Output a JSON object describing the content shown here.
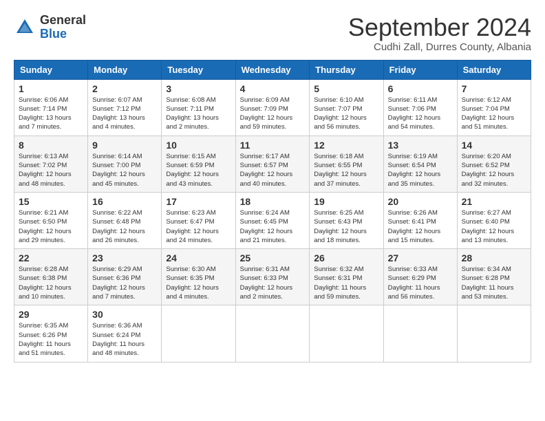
{
  "header": {
    "logo_general": "General",
    "logo_blue": "Blue",
    "month_title": "September 2024",
    "location": "Cudhi Zall, Durres County, Albania"
  },
  "days_of_week": [
    "Sunday",
    "Monday",
    "Tuesday",
    "Wednesday",
    "Thursday",
    "Friday",
    "Saturday"
  ],
  "weeks": [
    [
      {
        "day": "1",
        "info": "Sunrise: 6:06 AM\nSunset: 7:14 PM\nDaylight: 13 hours\nand 7 minutes."
      },
      {
        "day": "2",
        "info": "Sunrise: 6:07 AM\nSunset: 7:12 PM\nDaylight: 13 hours\nand 4 minutes."
      },
      {
        "day": "3",
        "info": "Sunrise: 6:08 AM\nSunset: 7:11 PM\nDaylight: 13 hours\nand 2 minutes."
      },
      {
        "day": "4",
        "info": "Sunrise: 6:09 AM\nSunset: 7:09 PM\nDaylight: 12 hours\nand 59 minutes."
      },
      {
        "day": "5",
        "info": "Sunrise: 6:10 AM\nSunset: 7:07 PM\nDaylight: 12 hours\nand 56 minutes."
      },
      {
        "day": "6",
        "info": "Sunrise: 6:11 AM\nSunset: 7:06 PM\nDaylight: 12 hours\nand 54 minutes."
      },
      {
        "day": "7",
        "info": "Sunrise: 6:12 AM\nSunset: 7:04 PM\nDaylight: 12 hours\nand 51 minutes."
      }
    ],
    [
      {
        "day": "8",
        "info": "Sunrise: 6:13 AM\nSunset: 7:02 PM\nDaylight: 12 hours\nand 48 minutes."
      },
      {
        "day": "9",
        "info": "Sunrise: 6:14 AM\nSunset: 7:00 PM\nDaylight: 12 hours\nand 45 minutes."
      },
      {
        "day": "10",
        "info": "Sunrise: 6:15 AM\nSunset: 6:59 PM\nDaylight: 12 hours\nand 43 minutes."
      },
      {
        "day": "11",
        "info": "Sunrise: 6:17 AM\nSunset: 6:57 PM\nDaylight: 12 hours\nand 40 minutes."
      },
      {
        "day": "12",
        "info": "Sunrise: 6:18 AM\nSunset: 6:55 PM\nDaylight: 12 hours\nand 37 minutes."
      },
      {
        "day": "13",
        "info": "Sunrise: 6:19 AM\nSunset: 6:54 PM\nDaylight: 12 hours\nand 35 minutes."
      },
      {
        "day": "14",
        "info": "Sunrise: 6:20 AM\nSunset: 6:52 PM\nDaylight: 12 hours\nand 32 minutes."
      }
    ],
    [
      {
        "day": "15",
        "info": "Sunrise: 6:21 AM\nSunset: 6:50 PM\nDaylight: 12 hours\nand 29 minutes."
      },
      {
        "day": "16",
        "info": "Sunrise: 6:22 AM\nSunset: 6:48 PM\nDaylight: 12 hours\nand 26 minutes."
      },
      {
        "day": "17",
        "info": "Sunrise: 6:23 AM\nSunset: 6:47 PM\nDaylight: 12 hours\nand 24 minutes."
      },
      {
        "day": "18",
        "info": "Sunrise: 6:24 AM\nSunset: 6:45 PM\nDaylight: 12 hours\nand 21 minutes."
      },
      {
        "day": "19",
        "info": "Sunrise: 6:25 AM\nSunset: 6:43 PM\nDaylight: 12 hours\nand 18 minutes."
      },
      {
        "day": "20",
        "info": "Sunrise: 6:26 AM\nSunset: 6:41 PM\nDaylight: 12 hours\nand 15 minutes."
      },
      {
        "day": "21",
        "info": "Sunrise: 6:27 AM\nSunset: 6:40 PM\nDaylight: 12 hours\nand 13 minutes."
      }
    ],
    [
      {
        "day": "22",
        "info": "Sunrise: 6:28 AM\nSunset: 6:38 PM\nDaylight: 12 hours\nand 10 minutes."
      },
      {
        "day": "23",
        "info": "Sunrise: 6:29 AM\nSunset: 6:36 PM\nDaylight: 12 hours\nand 7 minutes."
      },
      {
        "day": "24",
        "info": "Sunrise: 6:30 AM\nSunset: 6:35 PM\nDaylight: 12 hours\nand 4 minutes."
      },
      {
        "day": "25",
        "info": "Sunrise: 6:31 AM\nSunset: 6:33 PM\nDaylight: 12 hours\nand 2 minutes."
      },
      {
        "day": "26",
        "info": "Sunrise: 6:32 AM\nSunset: 6:31 PM\nDaylight: 11 hours\nand 59 minutes."
      },
      {
        "day": "27",
        "info": "Sunrise: 6:33 AM\nSunset: 6:29 PM\nDaylight: 11 hours\nand 56 minutes."
      },
      {
        "day": "28",
        "info": "Sunrise: 6:34 AM\nSunset: 6:28 PM\nDaylight: 11 hours\nand 53 minutes."
      }
    ],
    [
      {
        "day": "29",
        "info": "Sunrise: 6:35 AM\nSunset: 6:26 PM\nDaylight: 11 hours\nand 51 minutes."
      },
      {
        "day": "30",
        "info": "Sunrise: 6:36 AM\nSunset: 6:24 PM\nDaylight: 11 hours\nand 48 minutes."
      },
      {
        "day": "",
        "info": ""
      },
      {
        "day": "",
        "info": ""
      },
      {
        "day": "",
        "info": ""
      },
      {
        "day": "",
        "info": ""
      },
      {
        "day": "",
        "info": ""
      }
    ]
  ]
}
